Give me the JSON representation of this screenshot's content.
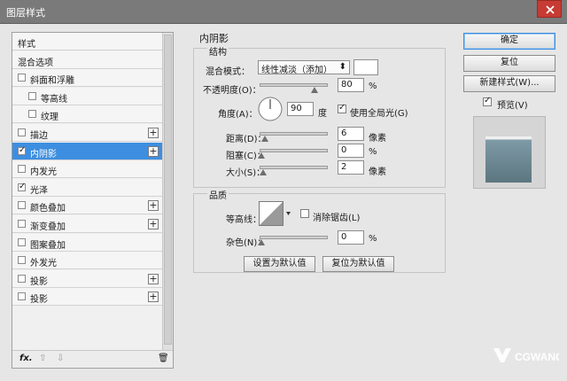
{
  "window": {
    "title": "图层样式"
  },
  "sidebar": {
    "items": [
      {
        "label": "样式",
        "checkbox": false,
        "checked": false,
        "plus": false,
        "indent": 0,
        "selected": false
      },
      {
        "label": "混合选项",
        "checkbox": false,
        "checked": false,
        "plus": false,
        "indent": 0,
        "selected": false
      },
      {
        "label": "斜面和浮雕",
        "checkbox": true,
        "checked": false,
        "plus": false,
        "indent": 0,
        "selected": false
      },
      {
        "label": "等高线",
        "checkbox": true,
        "checked": false,
        "plus": false,
        "indent": 1,
        "selected": false
      },
      {
        "label": "纹理",
        "checkbox": true,
        "checked": false,
        "plus": false,
        "indent": 1,
        "selected": false
      },
      {
        "label": "描边",
        "checkbox": true,
        "checked": false,
        "plus": true,
        "indent": 0,
        "selected": false
      },
      {
        "label": "内阴影",
        "checkbox": true,
        "checked": true,
        "plus": true,
        "indent": 0,
        "selected": true
      },
      {
        "label": "内发光",
        "checkbox": true,
        "checked": false,
        "plus": false,
        "indent": 0,
        "selected": false
      },
      {
        "label": "光泽",
        "checkbox": true,
        "checked": true,
        "plus": false,
        "indent": 0,
        "selected": false
      },
      {
        "label": "颜色叠加",
        "checkbox": true,
        "checked": false,
        "plus": true,
        "indent": 0,
        "selected": false
      },
      {
        "label": "渐变叠加",
        "checkbox": true,
        "checked": false,
        "plus": true,
        "indent": 0,
        "selected": false
      },
      {
        "label": "图案叠加",
        "checkbox": true,
        "checked": false,
        "plus": false,
        "indent": 0,
        "selected": false
      },
      {
        "label": "外发光",
        "checkbox": true,
        "checked": false,
        "plus": false,
        "indent": 0,
        "selected": false
      },
      {
        "label": "投影",
        "checkbox": true,
        "checked": false,
        "plus": true,
        "indent": 0,
        "selected": false
      },
      {
        "label": "投影",
        "checkbox": true,
        "checked": false,
        "plus": true,
        "indent": 0,
        "selected": false
      }
    ],
    "footer": {
      "fx": "fx.",
      "up": "⇧",
      "down": "⇩",
      "trash": "🗑"
    }
  },
  "panel": {
    "title": "内阴影",
    "structure": {
      "title": "结构",
      "blend_mode_label": "混合模式：",
      "blend_mode_value": "线性减淡（添加）",
      "opacity_label": "不透明度(O)：",
      "opacity_value": "80",
      "opacity_percent": 80,
      "angle_label": "角度(A)：",
      "angle_value": "90",
      "angle_unit": "度",
      "global_light_label": "使用全局光(G)",
      "global_light_checked": true,
      "distance_label": "距离(D)：",
      "distance_value": "6",
      "distance_unit": "像素",
      "choke_label": "阻塞(C)：",
      "choke_value": "0",
      "choke_unit": "%",
      "size_label": "大小(S)：",
      "size_value": "2",
      "size_unit": "像素",
      "percent_sign": "%"
    },
    "quality": {
      "title": "品质",
      "contour_label": "等高线：",
      "antialias_label": "消除锯齿(L)",
      "antialias_checked": false,
      "noise_label": "杂色(N)：",
      "noise_value": "0",
      "noise_unit": "%"
    },
    "buttons": {
      "make_default": "设置为默认值",
      "reset_default": "复位为默认值"
    }
  },
  "right": {
    "ok": "确定",
    "reset": "复位",
    "new_style": "新建样式(W)...",
    "preview_label": "预览(V)",
    "preview_checked": true
  },
  "colors": {
    "accent": "#3d8ee0",
    "close": "#c63b33",
    "preview": "#607880"
  }
}
